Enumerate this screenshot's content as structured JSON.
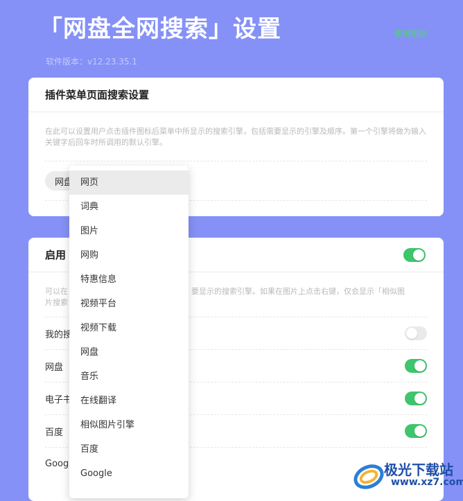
{
  "header": {
    "title": "「网盘全网搜索」设置",
    "help_link": "使用帮助",
    "version": "软件版本：v12.23.35.1"
  },
  "menu_card": {
    "title": "插件菜单页面搜索设置",
    "description": "在此可以设置用户点击插件图标后菜单中所显示的搜索引擎，包括需要显示的引擎及顺序。第一个引擎将做为输入关键字后回车时所调用的默认引擎。",
    "chip_label": "网盘"
  },
  "context_card": {
    "title": "启用",
    "enabled": true,
    "description_left": "可以在",
    "description_right": "要显示的搜索引擎。如果在图片上点击右键，仅会显示「相似图",
    "description_line2": "片搜索",
    "engines": [
      {
        "label": "我的搜",
        "enabled": false
      },
      {
        "label": "网盘",
        "enabled": true
      },
      {
        "label": "电子书",
        "enabled": true
      },
      {
        "label": "百度",
        "enabled": true
      },
      {
        "label": "Goog",
        "enabled": null
      }
    ]
  },
  "dropdown": {
    "selected_index": 0,
    "items": [
      "网页",
      "词典",
      "图片",
      "网购",
      "特惠信息",
      "视频平台",
      "视频下载",
      "网盘",
      "音乐",
      "在线翻译",
      "相似图片引擎",
      "百度",
      "Google"
    ]
  },
  "watermark": {
    "line1": "极光下载站",
    "line2": "www.xz7.com"
  },
  "colors": {
    "background": "#8591f6",
    "toggle_on": "#3fc56c",
    "help_link": "#4ed27a"
  }
}
